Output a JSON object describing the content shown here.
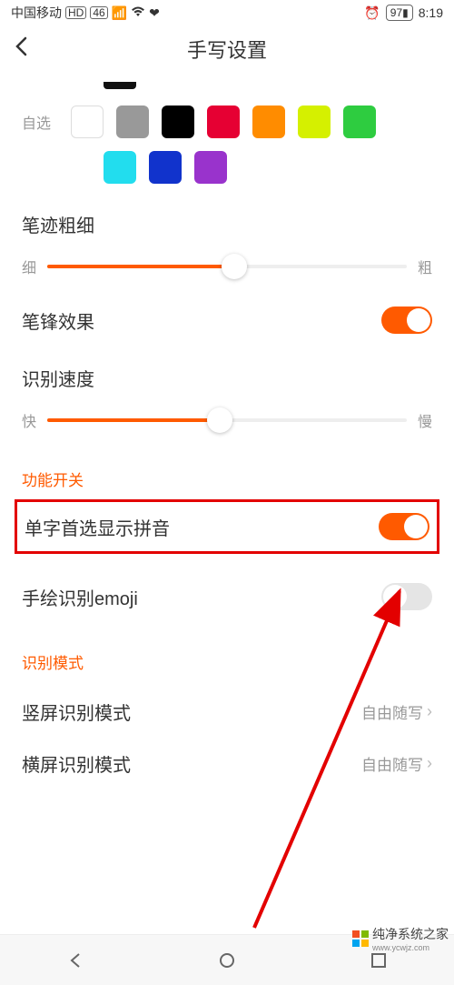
{
  "status": {
    "carrier": "中国移动",
    "hd": "HD",
    "net": "46",
    "battery_pct": "97",
    "time": "8:19"
  },
  "header": {
    "title": "手写设置"
  },
  "colors": {
    "row_label": "自选",
    "row1": [
      "#ffffff",
      "#999999",
      "#000000",
      "#e60033",
      "#ff8c00",
      "#d5f000",
      "#2ecc40"
    ],
    "row2": [
      "#22ddee",
      "#1133cc",
      "#9933cc"
    ]
  },
  "thickness": {
    "title": "笔迹粗细",
    "left": "细",
    "right": "粗",
    "value_pct": 52
  },
  "stroke_effect": {
    "label": "笔锋效果",
    "on": true
  },
  "speed": {
    "title": "识别速度",
    "left": "快",
    "right": "慢",
    "value_pct": 48
  },
  "sections": {
    "features": "功能开关",
    "modes": "识别模式"
  },
  "features": {
    "pinyin": {
      "label": "单字首选显示拼音",
      "on": true
    },
    "emoji": {
      "label": "手绘识别emoji",
      "on": false
    }
  },
  "modes": {
    "portrait": {
      "label": "竖屏识别模式",
      "value": "自由随写"
    },
    "landscape": {
      "label": "横屏识别模式",
      "value": "自由随写"
    }
  },
  "watermark": {
    "text": "纯净系统之家",
    "url": "www.ycwjz.com"
  }
}
